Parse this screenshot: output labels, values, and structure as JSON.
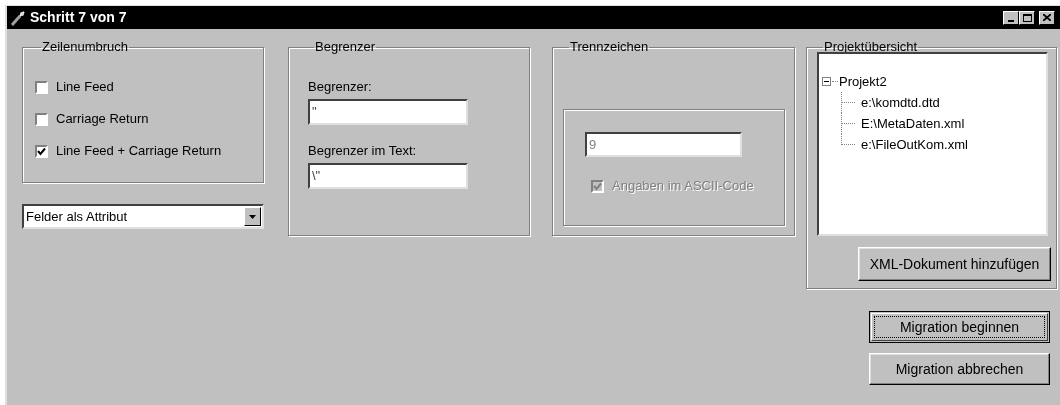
{
  "window": {
    "title": "Schritt 7 von 7"
  },
  "line_break": {
    "title": "Zeilenumbruch",
    "options": [
      {
        "label": "Line Feed",
        "checked": false
      },
      {
        "label": "Carriage Return",
        "checked": false
      },
      {
        "label": "Line Feed + Carriage Return",
        "checked": true
      }
    ]
  },
  "field_mode": {
    "value": "Felder als Attribut"
  },
  "delimiter": {
    "title": "Begrenzer",
    "fields": [
      {
        "label": "Begrenzer:",
        "value": "\""
      },
      {
        "label": "Begrenzer im Text:",
        "value": "\\\""
      }
    ]
  },
  "separator": {
    "title": "Trennzeichen",
    "value": "9",
    "disabled": true,
    "ascii": {
      "label": "Angaben im ASCII-Code",
      "checked": true,
      "disabled": true
    }
  },
  "project": {
    "title": "Projektübersicht",
    "tree": [
      {
        "label": "Projekt2",
        "expanded": true,
        "children": [
          {
            "label": "e:\\komdtd.dtd"
          },
          {
            "label": "E:\\MetaDaten.xml"
          },
          {
            "label": "e:\\FileOutKom.xml"
          }
        ]
      }
    ],
    "add_button": "XML-Dokument hinzufügen"
  },
  "actions": [
    {
      "label": "Migration beginnen",
      "default": true
    },
    {
      "label": "Migration abbrechen",
      "default": false
    }
  ]
}
